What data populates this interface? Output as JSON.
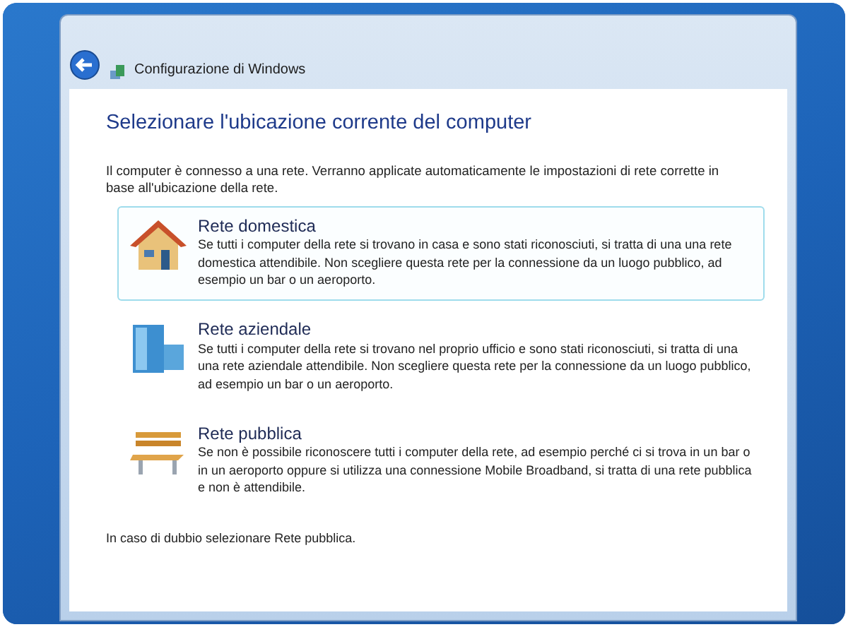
{
  "window": {
    "title": "Configurazione di Windows"
  },
  "heading": "Selezionare l'ubicazione corrente del computer",
  "intro": "Il computer è connesso a una rete. Verranno applicate automaticamente le impostazioni di rete corrette in base all'ubicazione della rete.",
  "options": [
    {
      "kind": "home",
      "title": "Rete domestica",
      "description": "Se tutti i computer della rete si trovano in casa e sono stati riconosciuti, si tratta di una una rete domestica attendibile. Non scegliere questa rete per la connessione da un luogo pubblico, ad esempio un bar o un aeroporto.",
      "selected": true
    },
    {
      "kind": "work",
      "title": "Rete aziendale",
      "description": "Se tutti i computer della rete si trovano nel proprio ufficio e sono stati riconosciuti, si tratta di una una rete aziendale attendibile. Non scegliere questa rete per la connessione da un luogo pubblico, ad esempio un bar o un aeroporto.",
      "selected": false
    },
    {
      "kind": "public",
      "title": "Rete pubblica",
      "description": "Se non è possibile riconoscere tutti i computer della rete, ad esempio perché ci si trova in un bar o in un aeroporto oppure si utilizza una connessione Mobile Broadband, si tratta di una rete pubblica e non è attendibile.",
      "selected": false
    }
  ],
  "footer": "In caso di dubbio selezionare Rete pubblica."
}
